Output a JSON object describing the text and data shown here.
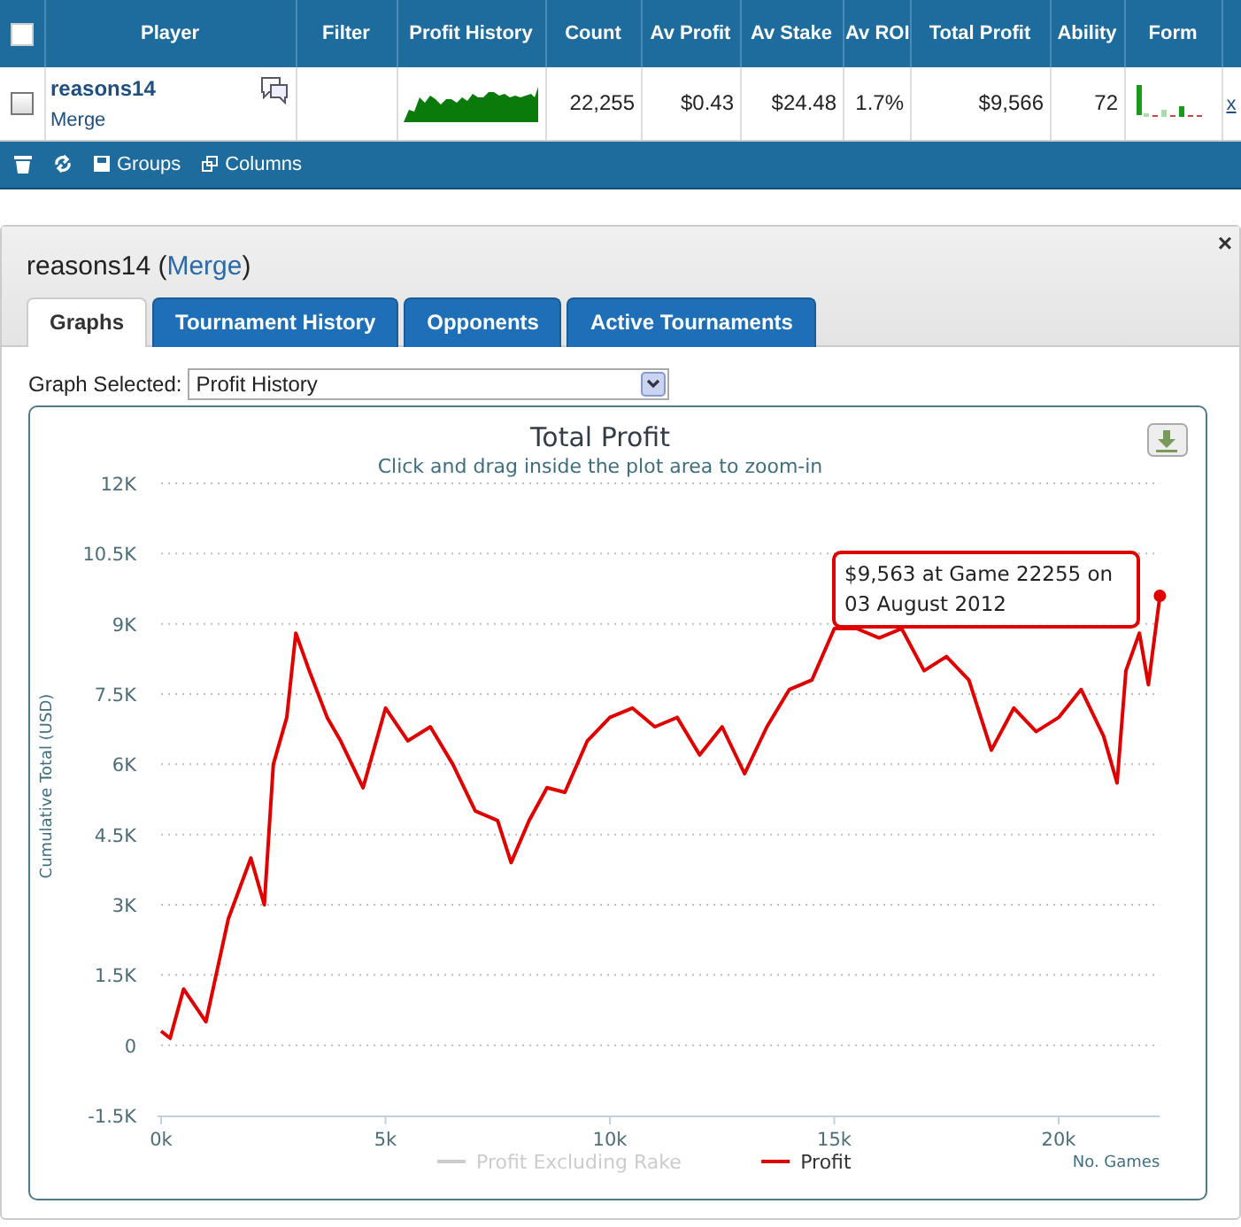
{
  "players_table": {
    "columns": [
      "Player",
      "Filter",
      "Profit History",
      "Count",
      "Av Profit",
      "Av Stake",
      "Av ROI",
      "Total Profit",
      "Ability",
      "Form"
    ],
    "header_checked": false,
    "rows": [
      {
        "checked": false,
        "player": "reasons14",
        "merge": "Merge",
        "filter": "",
        "count": "22,255",
        "av_profit": "$0.43",
        "av_stake": "$24.48",
        "av_roi": "1.7%",
        "total_profit": "$9,566",
        "ability": "72",
        "remove": "x"
      }
    ],
    "toolbar": [
      "Groups",
      "Columns"
    ]
  },
  "detail_panel": {
    "close": "×",
    "title_prefix": "reasons14 (",
    "merge": "Merge",
    "title_suffix": ")",
    "tabs": [
      {
        "label": "Graphs",
        "selected": true
      },
      {
        "label": "Tournament History",
        "selected": false
      },
      {
        "label": "Opponents",
        "selected": false
      },
      {
        "label": "Active Tournaments",
        "selected": false
      }
    ],
    "graph_select": {
      "label": "Graph Selected:",
      "value": "Profit History"
    },
    "chart": {
      "subtitle": "Click and drag inside the plot area to zoom-in",
      "tooltip": "$9,563 at Game 22255 on 03 August 2012",
      "chart_data": {
        "type": "line",
        "title": "Total Profit",
        "xlabel": "No. Games",
        "ylabel": "Cumulative Total (USD)",
        "x": [
          0,
          200,
          500,
          1000,
          1500,
          2000,
          2300,
          2500,
          2800,
          3000,
          3300,
          3700,
          4000,
          4500,
          5000,
          5500,
          6000,
          6500,
          7000,
          7500,
          7800,
          8200,
          8600,
          9000,
          9500,
          10000,
          10500,
          11000,
          11500,
          12000,
          12500,
          13000,
          13500,
          14000,
          14500,
          15000,
          15500,
          16000,
          16500,
          17000,
          17500,
          18000,
          18500,
          19000,
          19500,
          20000,
          20500,
          21000,
          21300,
          21500,
          21800,
          22000,
          22255
        ],
        "series": [
          {
            "name": "Profit Excluding Rake",
            "color": "#cccccc",
            "values": [
              null,
              null,
              null,
              null,
              null,
              null,
              null,
              null,
              null,
              null,
              null,
              null,
              null,
              null,
              null,
              null,
              null,
              null,
              null,
              null,
              null,
              null,
              null,
              null,
              null,
              null,
              null,
              null,
              null,
              null,
              null,
              null,
              null,
              null,
              null,
              null,
              null,
              null,
              null,
              null,
              null,
              null,
              null,
              null,
              null,
              null,
              null,
              null,
              null,
              null,
              null,
              null,
              null
            ]
          },
          {
            "name": "Profit",
            "color": "#e00000",
            "values": [
              300,
              150,
              1200,
              500,
              2700,
              4000,
              3000,
              6000,
              7000,
              8800,
              8000,
              7000,
              6500,
              5500,
              7200,
              6500,
              6800,
              6000,
              5000,
              4800,
              3900,
              4800,
              5500,
              5400,
              6500,
              7000,
              7200,
              6800,
              7000,
              6200,
              6800,
              5800,
              6800,
              7600,
              7800,
              8900,
              8900,
              8700,
              8900,
              8000,
              8300,
              7800,
              6300,
              7200,
              6700,
              7000,
              7600,
              6600,
              5600,
              8000,
              8800,
              7700,
              9600
            ]
          }
        ],
        "grid": true,
        "xlim": [
          0,
          22255
        ],
        "ylim": [
          -1500,
          12000
        ],
        "xticks": [
          {
            "value": 0,
            "label": "0k"
          },
          {
            "value": 5000,
            "label": "5k"
          },
          {
            "value": 10000,
            "label": "10k"
          },
          {
            "value": 15000,
            "label": "15k"
          },
          {
            "value": 20000,
            "label": "20k"
          }
        ],
        "yticks": [
          {
            "value": -1500,
            "label": "-1.5K"
          },
          {
            "value": 0,
            "label": "0"
          },
          {
            "value": 1500,
            "label": "1.5K"
          },
          {
            "value": 3000,
            "label": "3K"
          },
          {
            "value": 4500,
            "label": "4.5K"
          },
          {
            "value": 6000,
            "label": "6K"
          },
          {
            "value": 7500,
            "label": "7.5K"
          },
          {
            "value": 9000,
            "label": "9K"
          },
          {
            "value": 10500,
            "label": "10.5K"
          },
          {
            "value": 12000,
            "label": "12K"
          }
        ]
      }
    }
  }
}
